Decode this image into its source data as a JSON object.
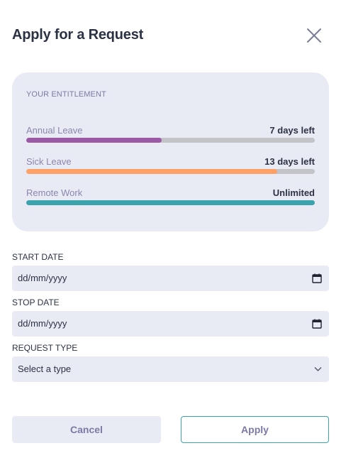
{
  "header": {
    "title": "Apply for a Request",
    "close_icon": "close-icon"
  },
  "entitlement": {
    "heading": "YOUR ENTITLEMENT",
    "items": [
      {
        "label": "Annual Leave",
        "remaining": "7 days left",
        "used_fraction": 0.47,
        "color": "#9b59a6"
      },
      {
        "label": "Sick Leave",
        "remaining": "13 days left",
        "used_fraction": 0.87,
        "color": "#ffa066"
      },
      {
        "label": "Remote Work",
        "remaining": "Unlimited",
        "used_fraction": 1.0,
        "color": "#3aa3ab"
      }
    ]
  },
  "form": {
    "start_date": {
      "label": "START DATE",
      "value": "dd/mm/yyyy",
      "icon": "calendar-icon"
    },
    "stop_date": {
      "label": "STOP DATE",
      "value": "dd/mm/yyyy",
      "icon": "calendar-icon"
    },
    "request_type": {
      "label": "REQUEST TYPE",
      "value": "Select a type",
      "icon": "chevron-down-icon"
    }
  },
  "actions": {
    "cancel_label": "Cancel",
    "apply_label": "Apply"
  }
}
